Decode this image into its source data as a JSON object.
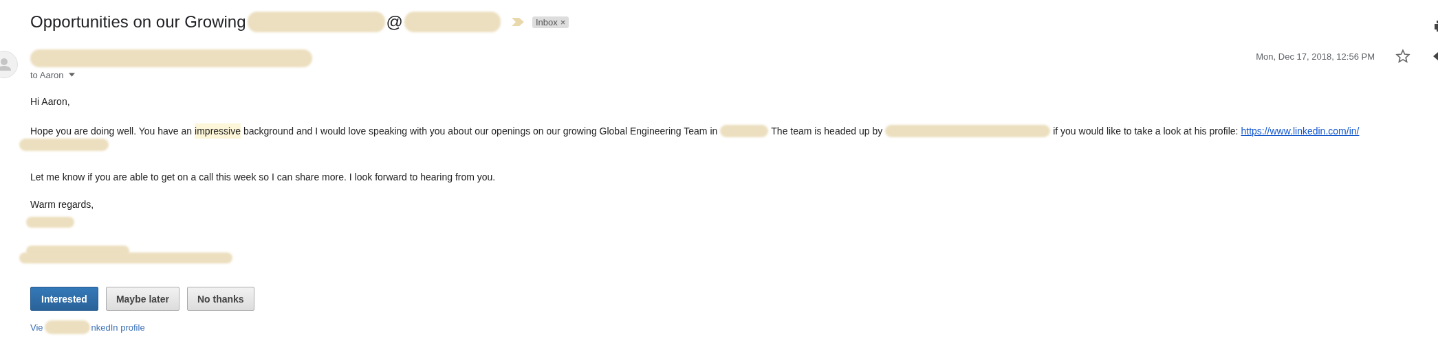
{
  "subject": {
    "parts": [
      {
        "kind": "text",
        "text": "Opportunities on our Growing"
      },
      {
        "kind": "redaction"
      },
      {
        "kind": "text",
        "text": "@"
      },
      {
        "kind": "redaction"
      }
    ],
    "important": true,
    "label": {
      "text": "Inbox",
      "remove": "×"
    }
  },
  "message": {
    "sender": {
      "kind": "redaction"
    },
    "recipient": "to Aaron",
    "date": "Mon, Dec 17, 2018, 12:56 PM",
    "starred": false,
    "greeting": "Hi Aaron,",
    "paragraph": [
      {
        "kind": "text",
        "text": "Hope you are doing well. You have an"
      },
      {
        "kind": "highlight",
        "text": "impressive"
      },
      {
        "kind": "text",
        "text": "background and I would love speaking with you about our openings on our growing Global Engineering Team in"
      },
      {
        "kind": "redaction"
      },
      {
        "kind": "text",
        "text": "The team is headed up by"
      },
      {
        "kind": "redaction"
      },
      {
        "kind": "text",
        "text": "if you would like to take a look at his profile:"
      },
      {
        "kind": "link",
        "text": "https://www.linkedin.com/in/"
      },
      {
        "kind": "redaction"
      }
    ],
    "closing_line": "Let me know if you are able to get on a call this week so I can share more. I look forward to hearing from you.",
    "signoff": "Warm regards,",
    "signature": [
      {
        "kind": "redaction"
      },
      {
        "kind": "redaction"
      },
      {
        "kind": "redaction"
      }
    ],
    "buttons": [
      {
        "label": "Interested",
        "primary": true
      },
      {
        "label": "Maybe later",
        "primary": false
      },
      {
        "label": "No thanks",
        "primary": false
      }
    ],
    "profile_link": [
      {
        "kind": "link",
        "text": "Vie"
      },
      {
        "kind": "redaction"
      },
      {
        "kind": "link",
        "text": "nkedIn profile"
      }
    ]
  }
}
